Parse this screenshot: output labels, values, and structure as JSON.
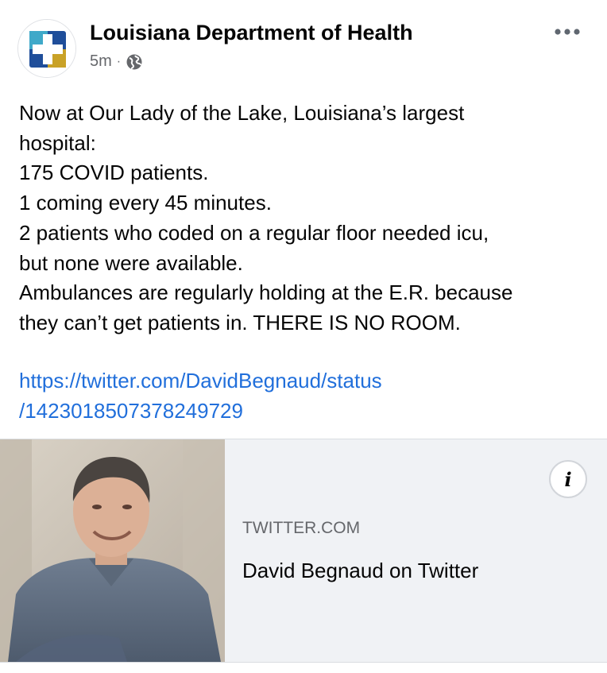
{
  "post": {
    "page_name": "Louisiana Department of Health",
    "timestamp": "5m",
    "separator": "·",
    "audience_icon": "globe-icon",
    "more_icon": "more-options-icon",
    "body_lines": [
      "Now at Our Lady of the Lake, Louisiana’s largest",
      "hospital:",
      "175 COVID patients.",
      "1 coming every 45 minutes.",
      "2 patients who coded on a regular floor needed icu,",
      "but none were available.",
      "Ambulances are regularly holding at the E.R. because",
      "they can’t get patients in. THERE IS NO ROOM."
    ],
    "link_lines": [
      "https://twitter.com/DavidBegnaud/status",
      "/1423018507378249729"
    ]
  },
  "link_card": {
    "domain": "TWITTER.COM",
    "title": "David Begnaud on Twitter",
    "info_label": "i",
    "thumbnail": "person-photo"
  },
  "colors": {
    "link": "#216fdb",
    "secondary_text": "#65676b",
    "card_background": "#f0f2f5",
    "logo_blue": "#1f4e9a",
    "logo_teal": "#3fa9c9",
    "logo_gold": "#c9a227"
  }
}
